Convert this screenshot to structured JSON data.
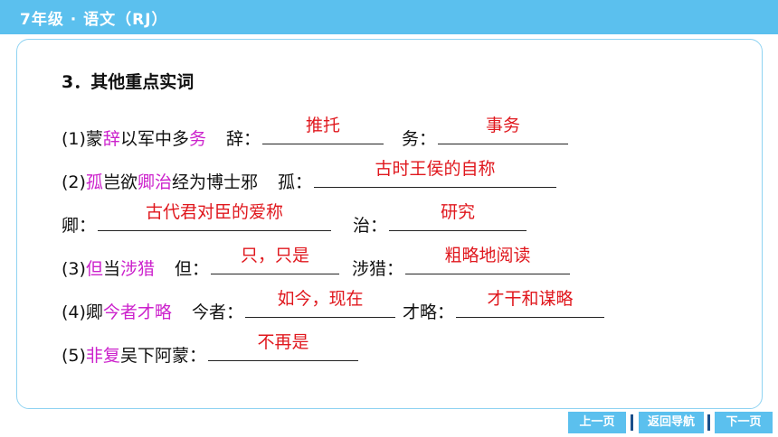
{
  "header": {
    "title": "7年级 · 语文（RJ）"
  },
  "heading": "3．其他重点实词",
  "lines": [
    {
      "a": "(1)蒙",
      "b": "辞",
      "c": "以军中多",
      "d": "务",
      "e": "辞：",
      "ans1": "推托",
      "f": "务：",
      "ans2": "事务"
    },
    {
      "a": "(2)",
      "b": "孤",
      "c": "岂欲",
      "d": "卿治",
      "e": "经为博士邪",
      "f": "孤：",
      "ans1": "古时王侯的自称"
    },
    {
      "a": "卿：",
      "ans1": "古代君对臣的爱称",
      "b": "治：",
      "ans2": "研究"
    },
    {
      "a": "(3)",
      "b": "但",
      "c": "当",
      "d": "涉猎",
      "e": "但：",
      "ans1": "只，只是",
      "f": "涉猎：",
      "ans2": "粗略地阅读"
    },
    {
      "a": "(4)卿",
      "b": "今者才略",
      "e": "今者：",
      "ans1": "如今，现在",
      "f": "才略：",
      "ans2": "才干和谋略"
    },
    {
      "a": "(5)",
      "b": "非复",
      "c": "吴下阿蒙：",
      "ans1": "不再是"
    }
  ],
  "nav": {
    "prev": "上一页",
    "home": "返回导航",
    "next": "下一页"
  },
  "colors": {
    "accent": "#5bc0ee",
    "answer": "#e0181e",
    "highlight": "#cc22cc"
  }
}
